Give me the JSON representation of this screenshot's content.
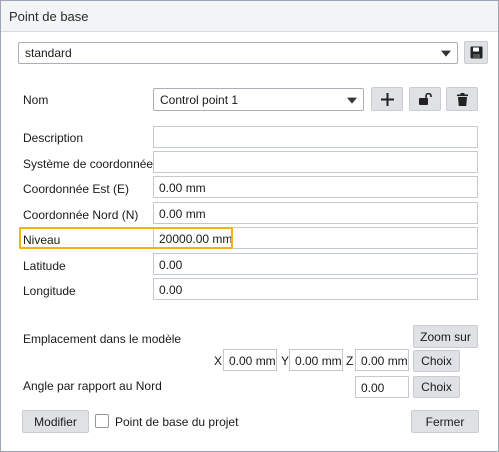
{
  "window": {
    "title": "Point de base"
  },
  "preset": {
    "value": "standard"
  },
  "nom": {
    "label": "Nom",
    "value": "Control point 1"
  },
  "fields": [
    {
      "label": "Description",
      "value": ""
    },
    {
      "label": "Système de coordonnées",
      "value": ""
    },
    {
      "label": "Coordonnée Est  (E)",
      "value": "0.00 mm"
    },
    {
      "label": "Coordonnée Nord  (N)",
      "value": "0.00 mm"
    },
    {
      "label": "Niveau",
      "value": "20000.00 mm"
    },
    {
      "label": "Latitude",
      "value": "0.00"
    },
    {
      "label": "Longitude",
      "value": "0.00"
    }
  ],
  "emplacement": {
    "label": "Emplacement dans le modèle",
    "zoom_button": "Zoom sur",
    "x_label": "X",
    "x_value": "0.00 mm",
    "y_label": "Y",
    "y_value": "0.00 mm",
    "z_label": "Z",
    "z_value": "0.00 mm",
    "choix_button": "Choix"
  },
  "angle": {
    "label": "Angle par rapport au Nord",
    "value": "0.00",
    "choix_button": "Choix"
  },
  "footer": {
    "modifier_button": "Modifier",
    "checkbox_label": "Point de base du projet",
    "checkbox_checked": false,
    "fermer_button": "Fermer"
  },
  "icons": {
    "save": "floppy-disk-icon",
    "add": "plus-icon",
    "unlock": "unlock-icon",
    "delete": "trash-icon",
    "dropdown": "chevron-down-icon"
  },
  "colors": {
    "highlight": "#f2b312",
    "button": "#dfe1e4"
  }
}
